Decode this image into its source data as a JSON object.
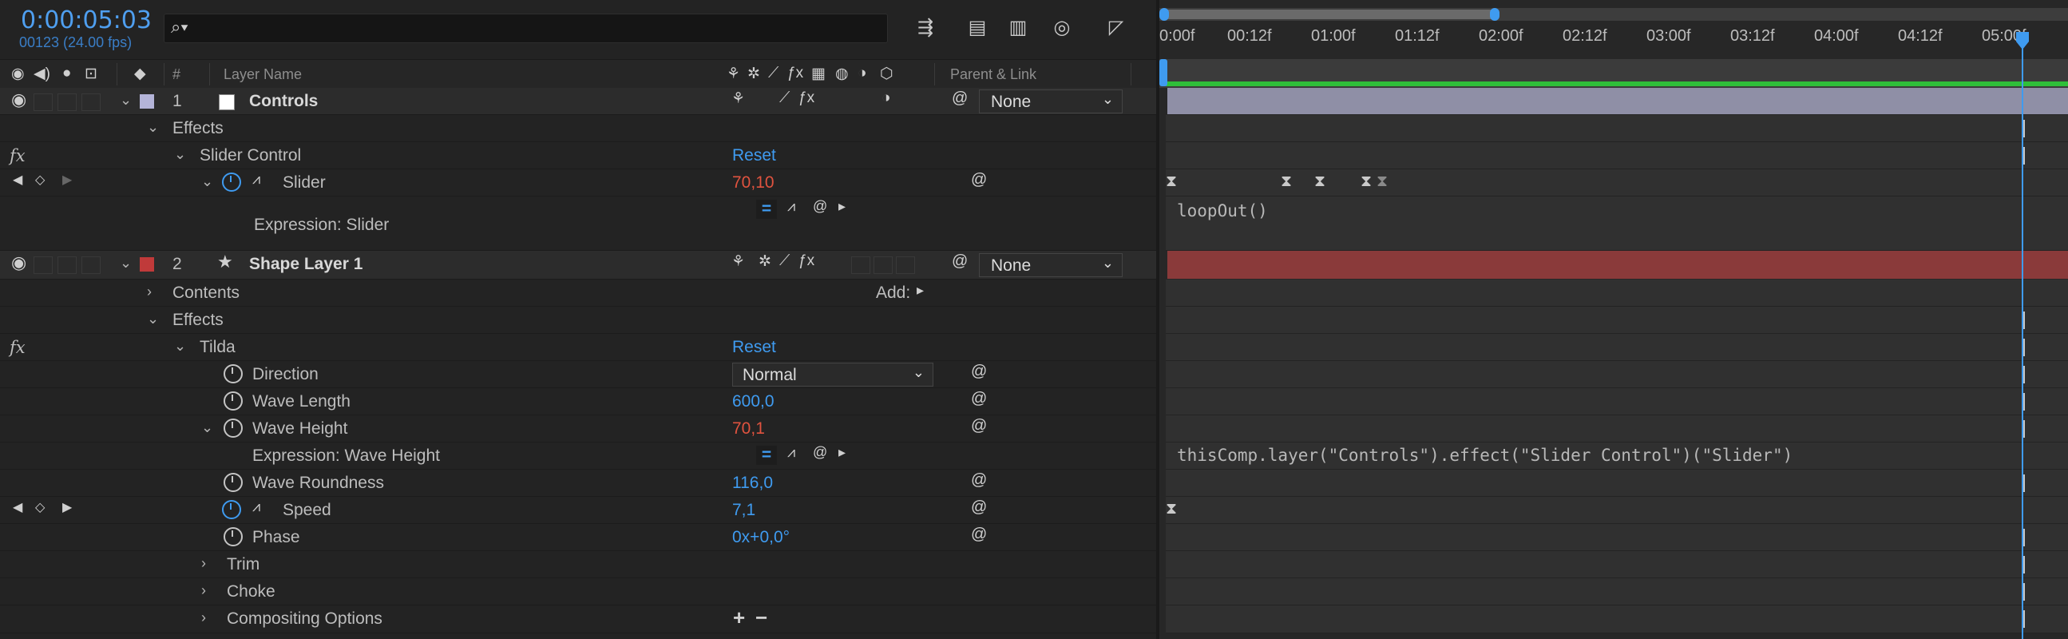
{
  "header": {
    "timecode": "0:00:05:03",
    "frame_info": "00123 (24.00 fps)",
    "search_icon": "search-icon"
  },
  "columns": {
    "num": "#",
    "layer_name": "Layer Name",
    "parent_link": "Parent & Link"
  },
  "layers": [
    {
      "num": "1",
      "name": "Controls",
      "label_color": "#b4b4d8",
      "parent": "None"
    },
    {
      "num": "2",
      "name": "Shape Layer 1",
      "label_color": "#c03a3a",
      "parent": "None"
    }
  ],
  "props": {
    "effects1": "Effects",
    "slider_control": "Slider Control",
    "reset": "Reset",
    "slider": "Slider",
    "slider_value": "70,10",
    "expression_slider": "Expression: Slider",
    "contents": "Contents",
    "add": "Add:",
    "effects2": "Effects",
    "tilda": "Tilda",
    "direction": "Direction",
    "direction_value": "Normal",
    "wave_length": "Wave Length",
    "wave_length_value": "600,0",
    "wave_height": "Wave Height",
    "wave_height_value": "70,1",
    "expression_wave_height": "Expression: Wave Height",
    "wave_roundness": "Wave Roundness",
    "wave_roundness_value": "116,0",
    "speed": "Speed",
    "speed_value": "7,1",
    "phase": "Phase",
    "phase_value": "0x+0,0°",
    "trim": "Trim",
    "choke": "Choke",
    "compositing": "Compositing Options",
    "fx": "fx"
  },
  "timeline": {
    "ticks": [
      "0:00f",
      "00:12f",
      "01:00f",
      "01:12f",
      "02:00f",
      "02:12f",
      "03:00f",
      "03:12f",
      "04:00f",
      "04:12f",
      "05:00f"
    ],
    "expr_slider": "loopOut()",
    "expr_wave_height": "thisComp.layer(\"Controls\").effect(\"Slider Control\")(\"Slider\")",
    "bar_controls_color": "#8f8fa6",
    "bar_shape_color": "#8a3a3a",
    "cti_color": "#3f9bf0"
  }
}
